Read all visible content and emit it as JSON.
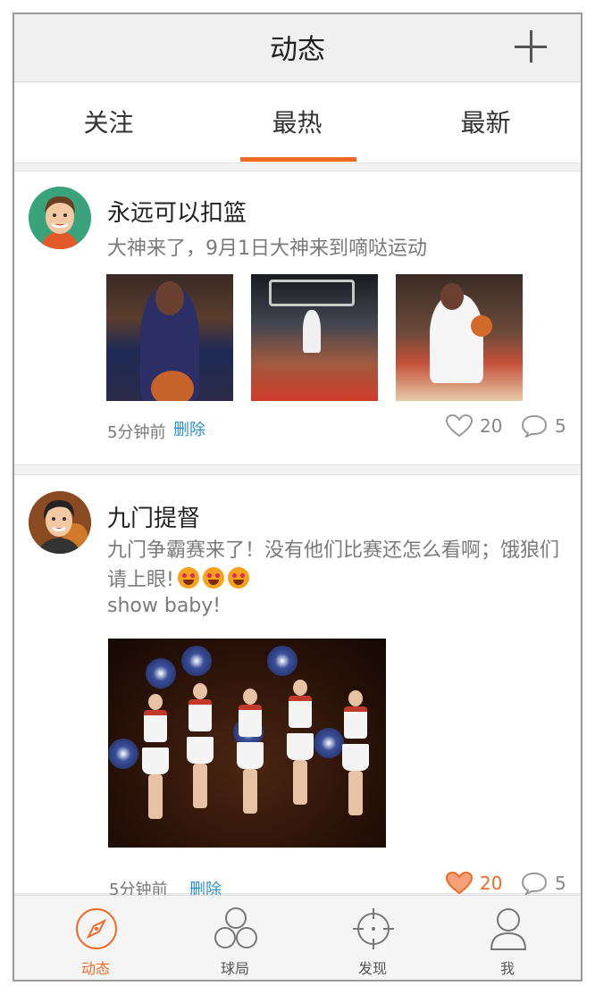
{
  "header": {
    "title": "动态",
    "add_icon": "plus-icon"
  },
  "tabs": [
    {
      "label": "关注",
      "active": false
    },
    {
      "label": "最热",
      "active": true
    },
    {
      "label": "最新",
      "active": false
    }
  ],
  "accent_color": "#f06a25",
  "link_color": "#2b8fd6",
  "posts": [
    {
      "username": "永远可以扣篮",
      "text": "大神来了，9月1日大神来到嘀哒运动",
      "time": "5分钟前",
      "delete_label": "删除",
      "likes": "20",
      "liked": false,
      "comments": "5"
    },
    {
      "username": "九门提督",
      "text": "九门争霸赛来了！没有他们比赛还怎么看啊；饿狼们请上眼!",
      "text2": "show baby!",
      "time": "5分钟前",
      "delete_label": "删除",
      "likes": "20",
      "liked": true,
      "comments": "5"
    }
  ],
  "tabbar": [
    {
      "label": "动态",
      "icon": "compass-icon",
      "active": true
    },
    {
      "label": "球局",
      "icon": "three-circles-icon",
      "active": false
    },
    {
      "label": "发现",
      "icon": "crosshair-icon",
      "active": false
    },
    {
      "label": "我",
      "icon": "user-icon",
      "active": false
    }
  ]
}
